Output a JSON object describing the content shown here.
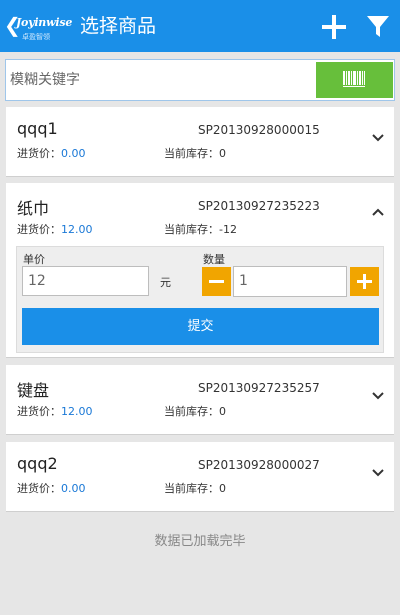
{
  "header": {
    "back_symbol": "❮",
    "brand": "Joyinwise",
    "brand_sub": "卓盈智领",
    "title": "选择商品",
    "add_icon": "plus-icon",
    "filter_icon": "filter-icon",
    "color": "#1a8fe8"
  },
  "search": {
    "placeholder": "模糊关键字",
    "value": "",
    "scan_icon": "barcode-icon",
    "scan_color": "#67bf3b"
  },
  "products": [
    {
      "name": "qqq1",
      "code": "SP20130928000015",
      "price_label": "进货价：",
      "price": "0.00",
      "stock_label": "当前库存：",
      "stock": "0",
      "expanded": false
    },
    {
      "name": "纸巾",
      "code": "SP20130927235223",
      "price_label": "进货价：",
      "price": "12.00",
      "stock_label": "当前库存：",
      "stock": "-12",
      "expanded": true
    },
    {
      "name": "键盘",
      "code": "SP20130927235257",
      "price_label": "进货价：",
      "price": "12.00",
      "stock_label": "当前库存：",
      "stock": "0",
      "expanded": false
    },
    {
      "name": "qqq2",
      "code": "SP20130928000027",
      "price_label": "进货价：",
      "price": "0.00",
      "stock_label": "当前库存：",
      "stock": "0",
      "expanded": false
    }
  ],
  "editor": {
    "unit_price_label": "单价",
    "unit_price_value": "12",
    "unit_suffix": "元",
    "quantity_label": "数量",
    "quantity_value": "1",
    "submit_label": "提交",
    "accent_color": "#f1a500"
  },
  "footer": {
    "status": "数据已加载完毕"
  }
}
